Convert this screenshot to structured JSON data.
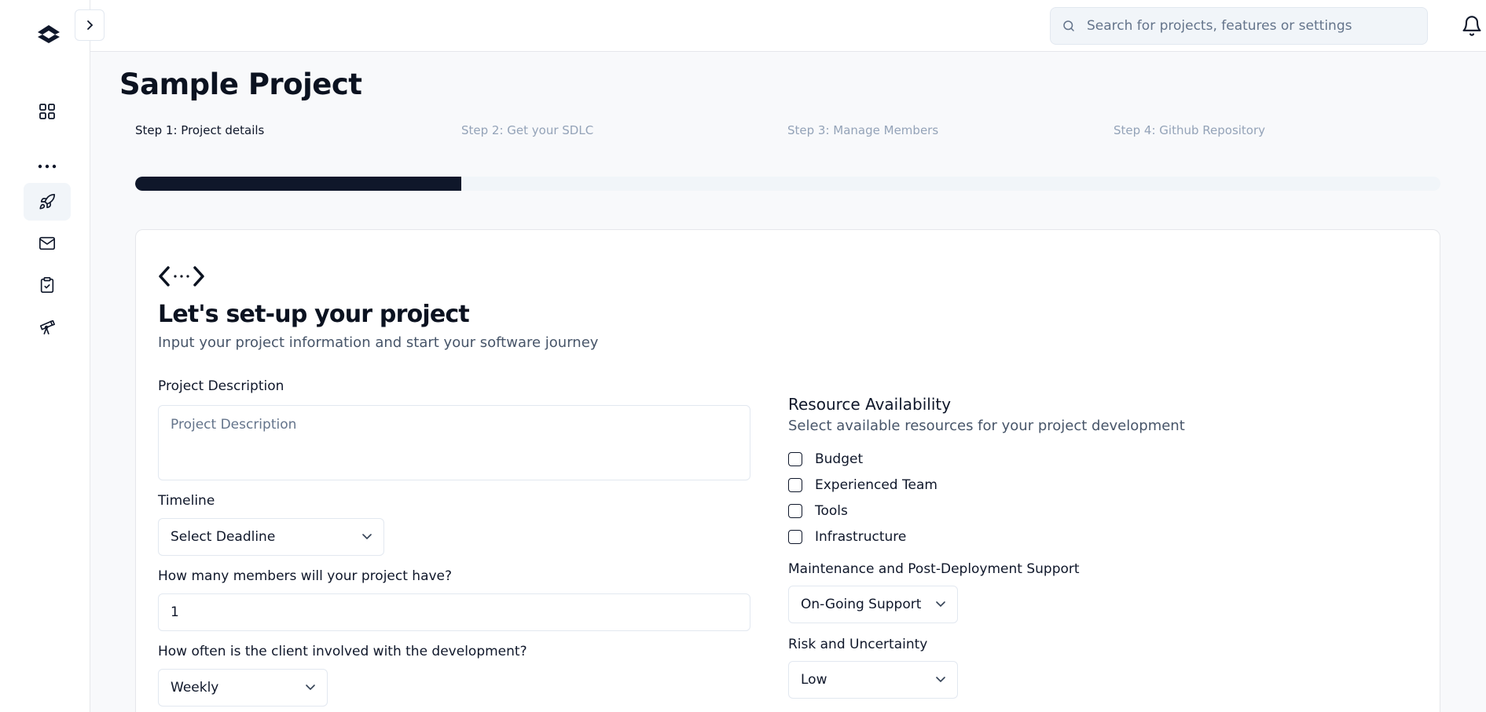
{
  "header": {
    "search_placeholder": "Search for projects, features or settings"
  },
  "page": {
    "title": "Sample Project"
  },
  "steps": [
    {
      "label": "Step 1: Project details",
      "active": true
    },
    {
      "label": "Step 2: Get your SDLC",
      "active": false
    },
    {
      "label": "Step 3: Manage Members",
      "active": false
    },
    {
      "label": "Step 4: Github Repository",
      "active": false
    }
  ],
  "progress": {
    "fraction": 0.25
  },
  "card": {
    "title": "Let's set-up your project",
    "subtitle": "Input your project information and start your software journey"
  },
  "form": {
    "description": {
      "label": "Project Description",
      "placeholder": "Project Description"
    },
    "timeline": {
      "label": "Timeline",
      "value": "Select Deadline"
    },
    "members": {
      "label": "How many members will your project have?",
      "value": "1"
    },
    "client": {
      "label": "How often is the client involved with the development?",
      "value": "Weekly"
    },
    "resources": {
      "title": "Resource Availability",
      "subtitle": "Select available resources for your project development",
      "options": [
        "Budget",
        "Experienced Team",
        "Tools",
        "Infrastructure"
      ]
    },
    "maintenance": {
      "label": "Maintenance and Post-Deployment Support",
      "value": "On-Going Support"
    },
    "risk": {
      "label": "Risk and Uncertainty",
      "value": "Low"
    }
  },
  "icons": {
    "logo": "chevron-logo-icon",
    "sidebar": [
      "dashboard-grid-icon",
      "more-dots-icon",
      "rocket-icon",
      "mail-icon",
      "clipboard-check-icon",
      "telescope-icon"
    ]
  },
  "colors": {
    "primary": "#0f172a",
    "muted": "#94a3b8",
    "track": "#f1f5f9"
  }
}
